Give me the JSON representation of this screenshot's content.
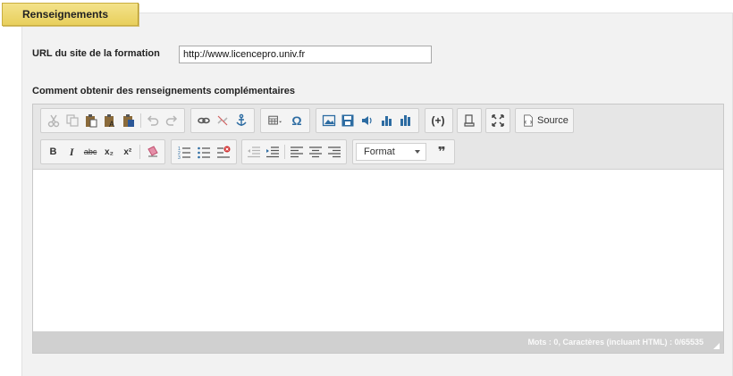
{
  "section": {
    "tab_label": "Renseignements"
  },
  "url_field": {
    "label": "URL du site de la formation",
    "value": "http://www.licencepro.univ.fr"
  },
  "comment_field": {
    "label": "Comment obtenir des renseignements complémentaires"
  },
  "editor": {
    "source_label": "Source",
    "format_label": "Format",
    "status": "Mots : 0, Caractères (incluant HTML) : 0/65535",
    "bold": "B",
    "italic": "I",
    "strike": "abc",
    "subscript": "x₂",
    "superscript": "x²",
    "omega": "Ω",
    "blockquote": "❞"
  }
}
